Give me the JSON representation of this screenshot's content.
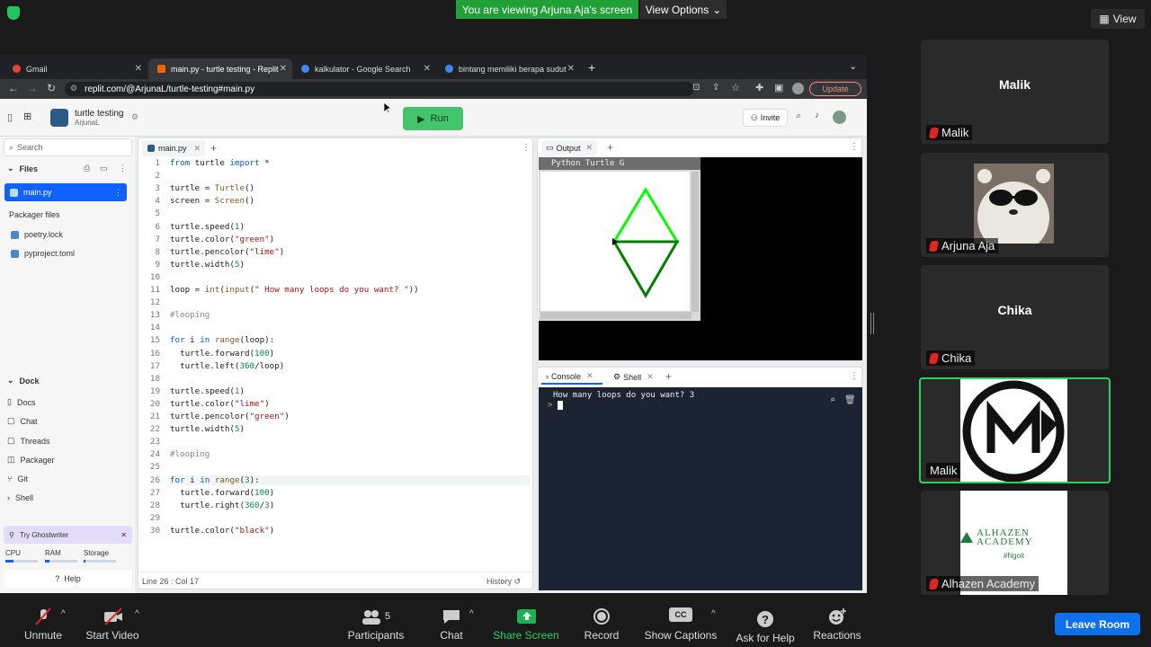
{
  "zoom": {
    "share_banner": "You are viewing Arjuna Aja's screen",
    "view_options": "View Options",
    "view_button": "View",
    "toolbar": {
      "unmute": "Unmute",
      "start_video": "Start Video",
      "participants": "Participants",
      "participants_count": "5",
      "chat": "Chat",
      "share_screen": "Share Screen",
      "record": "Record",
      "show_captions": "Show Captions",
      "captions_icon_text": "CC",
      "ask_for_help": "Ask for Help",
      "reactions": "Reactions",
      "leave_room": "Leave Room"
    },
    "participants": [
      {
        "name": "Malik",
        "center_label": "Malik"
      },
      {
        "name": "Arjuna Aja"
      },
      {
        "name": "Chika",
        "center_label": "Chika"
      },
      {
        "name": "Malik"
      },
      {
        "name": "Alhazen Academy"
      }
    ],
    "alhazen_logo": {
      "line1": "ALHAZEN",
      "line2": "ACADEMY",
      "line3": "#Ngoit"
    }
  },
  "browser": {
    "tabs": [
      {
        "label": "Gmail"
      },
      {
        "label": "main.py - turtle testing - Replit"
      },
      {
        "label": "kalkulator - Google Search"
      },
      {
        "label": "bintang memiliki berapa sudut"
      }
    ],
    "url": "replit.com/@ArjunaL/turtle-testing#main.py",
    "update_label": "Update"
  },
  "replit": {
    "project_name": "turtle testing",
    "owner": "ArjunaL",
    "run_label": "Run",
    "invite_label": "Invite",
    "search_placeholder": "Search",
    "files_label": "Files",
    "active_file": "main.py",
    "packager_files_label": "Packager files",
    "packager_files": [
      "poetry.lock",
      "pyproject.toml"
    ],
    "dock_label": "Dock",
    "dock_items": [
      "Docs",
      "Chat",
      "Threads",
      "Packager",
      "Git",
      "Shell"
    ],
    "ghostwriter": "Try Ghostwriter",
    "resources": [
      "CPU",
      "RAM",
      "Storage"
    ],
    "help_label": "Help",
    "editor_tab": "main.py",
    "status_position": "Line 26 : Col 17",
    "history_label": "History",
    "output_tab": "Output",
    "turtle_window_title": "Python Turtle G",
    "console_tab": "Console",
    "shell_tab": "Shell",
    "console_lines": [
      "How many loops do you want? 3"
    ],
    "prompt_symbol": ">",
    "code": [
      "from turtle import *",
      "",
      "turtle = Turtle()",
      "screen = Screen()",
      "",
      "turtle.speed(1)",
      "turtle.color(\"green\")",
      "turtle.pencolor(\"lime\")",
      "turtle.width(5)",
      "",
      "loop = int(input(\" How many loops do you want? \"))",
      "",
      "#looping",
      "",
      "for i in range(loop):",
      "  turtle.forward(100)",
      "  turtle.left(360/loop)",
      "",
      "turtle.speed(1)",
      "turtle.color(\"lime\")",
      "turtle.pencolor(\"green\")",
      "turtle.width(5)",
      "",
      "#looping",
      "",
      "for i in range(3):",
      "  turtle.forward(100)",
      "  turtle.right(360/3)",
      "",
      "turtle.color(\"black\")"
    ]
  },
  "colors": {
    "share_green": "#21a038",
    "run_green": "#45c46e",
    "leave_blue": "#0e71eb",
    "lime": "#00ff00",
    "green": "#008000"
  }
}
